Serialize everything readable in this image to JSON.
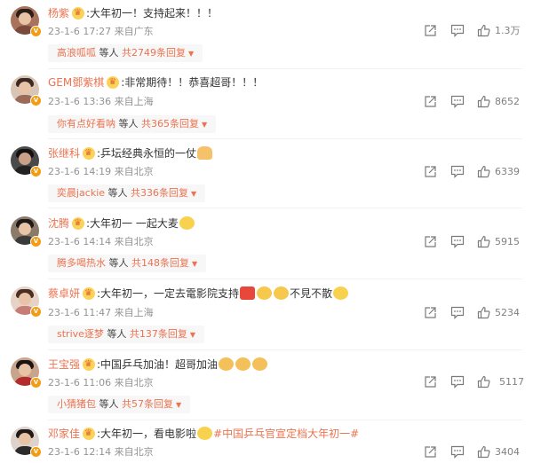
{
  "comments": [
    {
      "user": "杨紫",
      "text": ":大年初一！支持起来！！！",
      "emojis": [],
      "time": "23-1-6 17:27",
      "location": "来自广东",
      "likes": "1.3万",
      "reply": {
        "user": "高浪呱呱",
        "mid": "等人",
        "count": "共2749条回复"
      },
      "avatar_color": "#a8735c"
    },
    {
      "user": "GEM鄧紫棋",
      "text": ":非常期待！！恭喜超哥！！！",
      "emojis": [],
      "time": "23-1-6 13:36",
      "location": "来自上海",
      "likes": "8652",
      "reply": {
        "user": "你有点好看呐",
        "mid": "等人",
        "count": "共365条回复"
      },
      "avatar_color": "#c9a28a"
    },
    {
      "user": "张继科",
      "text": ":乒坛经典永恒的一仗",
      "emojis": [
        "folded-hands"
      ],
      "time": "23-1-6 14:19",
      "location": "来自北京",
      "likes": "6339",
      "reply": {
        "user": "奕晨jackie",
        "mid": "等人",
        "count": "共336条回复"
      },
      "avatar_color": "#3a3a3a"
    },
    {
      "user": "沈腾",
      "text": ":大年初一 一起大麦",
      "emojis": [
        "grinning-sweat"
      ],
      "time": "23-1-6 14:14",
      "location": "来自北京",
      "likes": "5915",
      "reply": {
        "user": "腾多喝热水",
        "mid": "等人",
        "count": "共148条回复"
      },
      "avatar_color": "#6b5a4b"
    },
    {
      "user": "蔡卓妍",
      "text": ":大年初一，一定去電影院支持",
      "text2": "不見不散",
      "emojis": [
        "jia-you-tag",
        "point-left",
        "point-left",
        "sunglasses"
      ],
      "time": "23-1-6 11:47",
      "location": "来自上海",
      "likes": "5234",
      "reply": {
        "user": "strive逐梦",
        "mid": "等人",
        "count": "共137条回复"
      },
      "avatar_color": "#d9b3a0"
    },
    {
      "user": "王宝强",
      "text": ":中国乒乓加油！超哥加油",
      "emojis": [
        "fist",
        "fist",
        "fist"
      ],
      "time": "23-1-6 11:06",
      "location": "来自北京",
      "likes": "5117",
      "reply": {
        "user": "小猜猪包",
        "mid": "等人",
        "count": "共57条回复"
      },
      "avatar_color": "#b52a2a"
    },
    {
      "user": "邓家佳",
      "text": ":大年初一，看电影啦",
      "hashtag": "#中国乒乓官宣定档大年初一#",
      "emojis": [
        "surprised"
      ],
      "time": "23-1-6 12:14",
      "location": "来自北京",
      "likes": "3404",
      "avatar_color": "#2b2b2b"
    }
  ],
  "theme": {
    "accent": "#eb7350",
    "meta": "#939393",
    "reply_bg": "#f7f7f7"
  },
  "icons": [
    "forward-icon",
    "comment-icon",
    "like-icon",
    "verified-badge-icon",
    "crown-icon",
    "chevron-down-icon"
  ]
}
